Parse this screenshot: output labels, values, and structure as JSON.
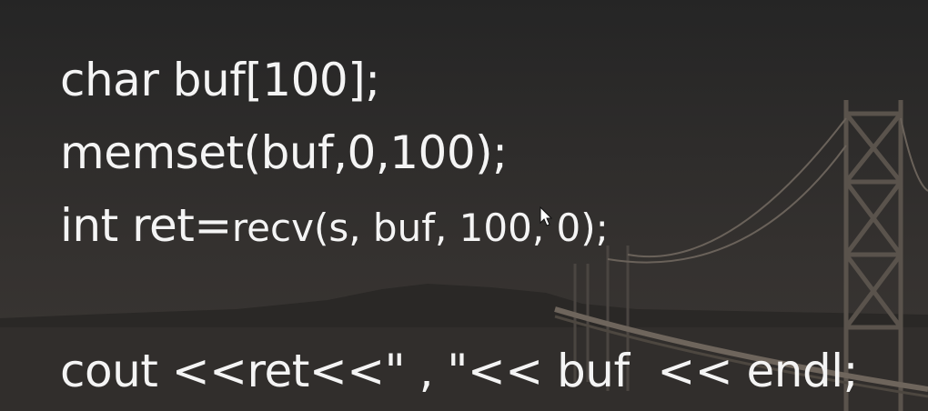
{
  "code": {
    "line1": "char buf[100];",
    "line2": "memset(buf,0,100);",
    "line3_prefix": "int ret=",
    "line3_call": "recv(s, buf, 100, 0);",
    "line5": "cout <<ret<<\" , \"<< buf  << endl;"
  },
  "colors": {
    "text": "#f4f4f4",
    "background": "#2b2a2a"
  },
  "icons": {
    "pointer": "mouse-pointer-icon"
  }
}
